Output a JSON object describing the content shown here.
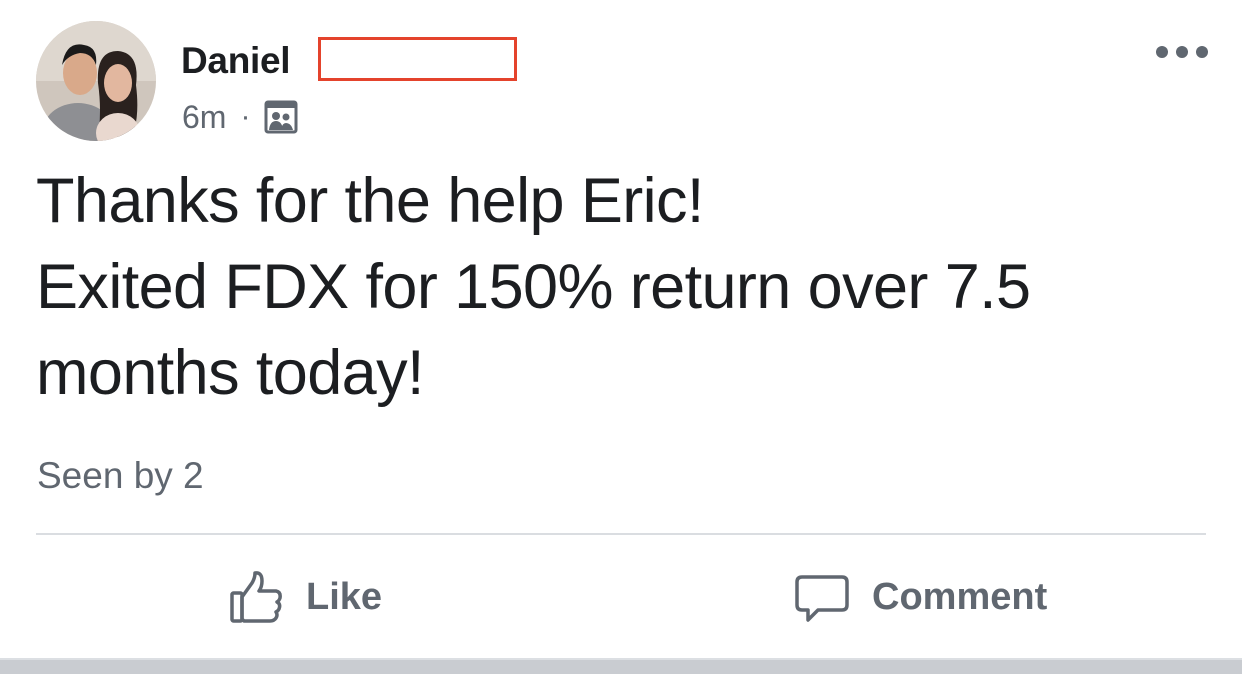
{
  "post": {
    "author": {
      "name": "Daniel",
      "avatar_icon": "profile-photo-couple"
    },
    "meta": {
      "time": "6m",
      "separator": "·",
      "audience_icon": "friends-privacy-icon"
    },
    "menu_icon": "more-options-icon",
    "body_lines": [
      "Thanks for the help Eric!",
      "Exited FDX for 150% return over 7.5",
      "months today!"
    ],
    "seen_by": "Seen by 2"
  },
  "actions": {
    "like_label": "Like",
    "like_icon": "thumbs-up-icon",
    "comment_label": "Comment",
    "comment_icon": "speech-bubble-icon"
  },
  "colors": {
    "primary_text": "#1c1e21",
    "secondary_text": "#606770",
    "divider": "#dadde1",
    "redaction_box": "#e4432c"
  }
}
